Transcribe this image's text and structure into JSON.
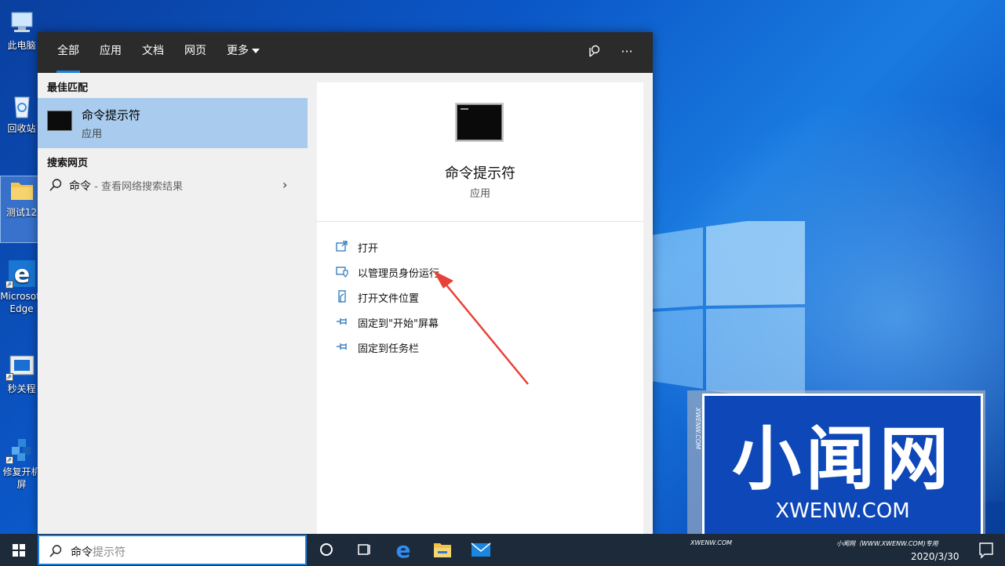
{
  "desktop": {
    "icons": [
      {
        "label": "此电脑",
        "icon": "computer-icon"
      },
      {
        "label": "回收站",
        "icon": "recycle-bin-icon"
      },
      {
        "label": "测试12",
        "icon": "folder-icon"
      },
      {
        "label": "Microsoft Edge",
        "icon": "edge-icon"
      },
      {
        "label": "秒关程",
        "icon": "app-window-icon"
      },
      {
        "label": "修复开机屏",
        "icon": "repair-cube-icon"
      }
    ]
  },
  "search_panel": {
    "tabs": [
      {
        "label": "全部",
        "active": true
      },
      {
        "label": "应用",
        "active": false
      },
      {
        "label": "文档",
        "active": false
      },
      {
        "label": "网页",
        "active": false
      },
      {
        "label": "更多",
        "active": false
      }
    ],
    "feedback_icon": "feedback-icon",
    "more_options_label": "···",
    "best_match_heading": "最佳匹配",
    "best_match": {
      "name": "命令提示符",
      "kind": "应用"
    },
    "web_heading": "搜索网页",
    "web_result": {
      "query": "命令",
      "hint": " - 查看网络搜索结果"
    },
    "detail": {
      "name": "命令提示符",
      "kind": "应用"
    },
    "actions": [
      {
        "label": "打开",
        "icon": "open-icon"
      },
      {
        "label": "以管理员身份运行",
        "icon": "admin-shield-icon"
      },
      {
        "label": "打开文件位置",
        "icon": "file-location-icon"
      },
      {
        "label": "固定到\"开始\"屏幕",
        "icon": "pin-start-icon"
      },
      {
        "label": "固定到任务栏",
        "icon": "pin-taskbar-icon"
      }
    ]
  },
  "watermark": {
    "title": "小闻网",
    "domain": "XWENW.COM",
    "side_text": "XWENW.COM",
    "foot_left": "XWENW.COM",
    "foot_right": "小闻网（WWW.XWENW.COM)专用"
  },
  "taskbar": {
    "search_typed": "命令",
    "search_rest": "提示符",
    "apps": [
      "cortana-circle-icon",
      "task-view-icon",
      "edge-icon",
      "file-explorer-icon",
      "mail-icon"
    ],
    "date": "2020/3/30",
    "time": ""
  },
  "colors": {
    "accent": "#1b7fe0",
    "best_match_bg": "#a9cbed",
    "panel_header": "#2b2b2b",
    "taskbar": "#1d2a3a",
    "arrow": "#e8413a"
  }
}
